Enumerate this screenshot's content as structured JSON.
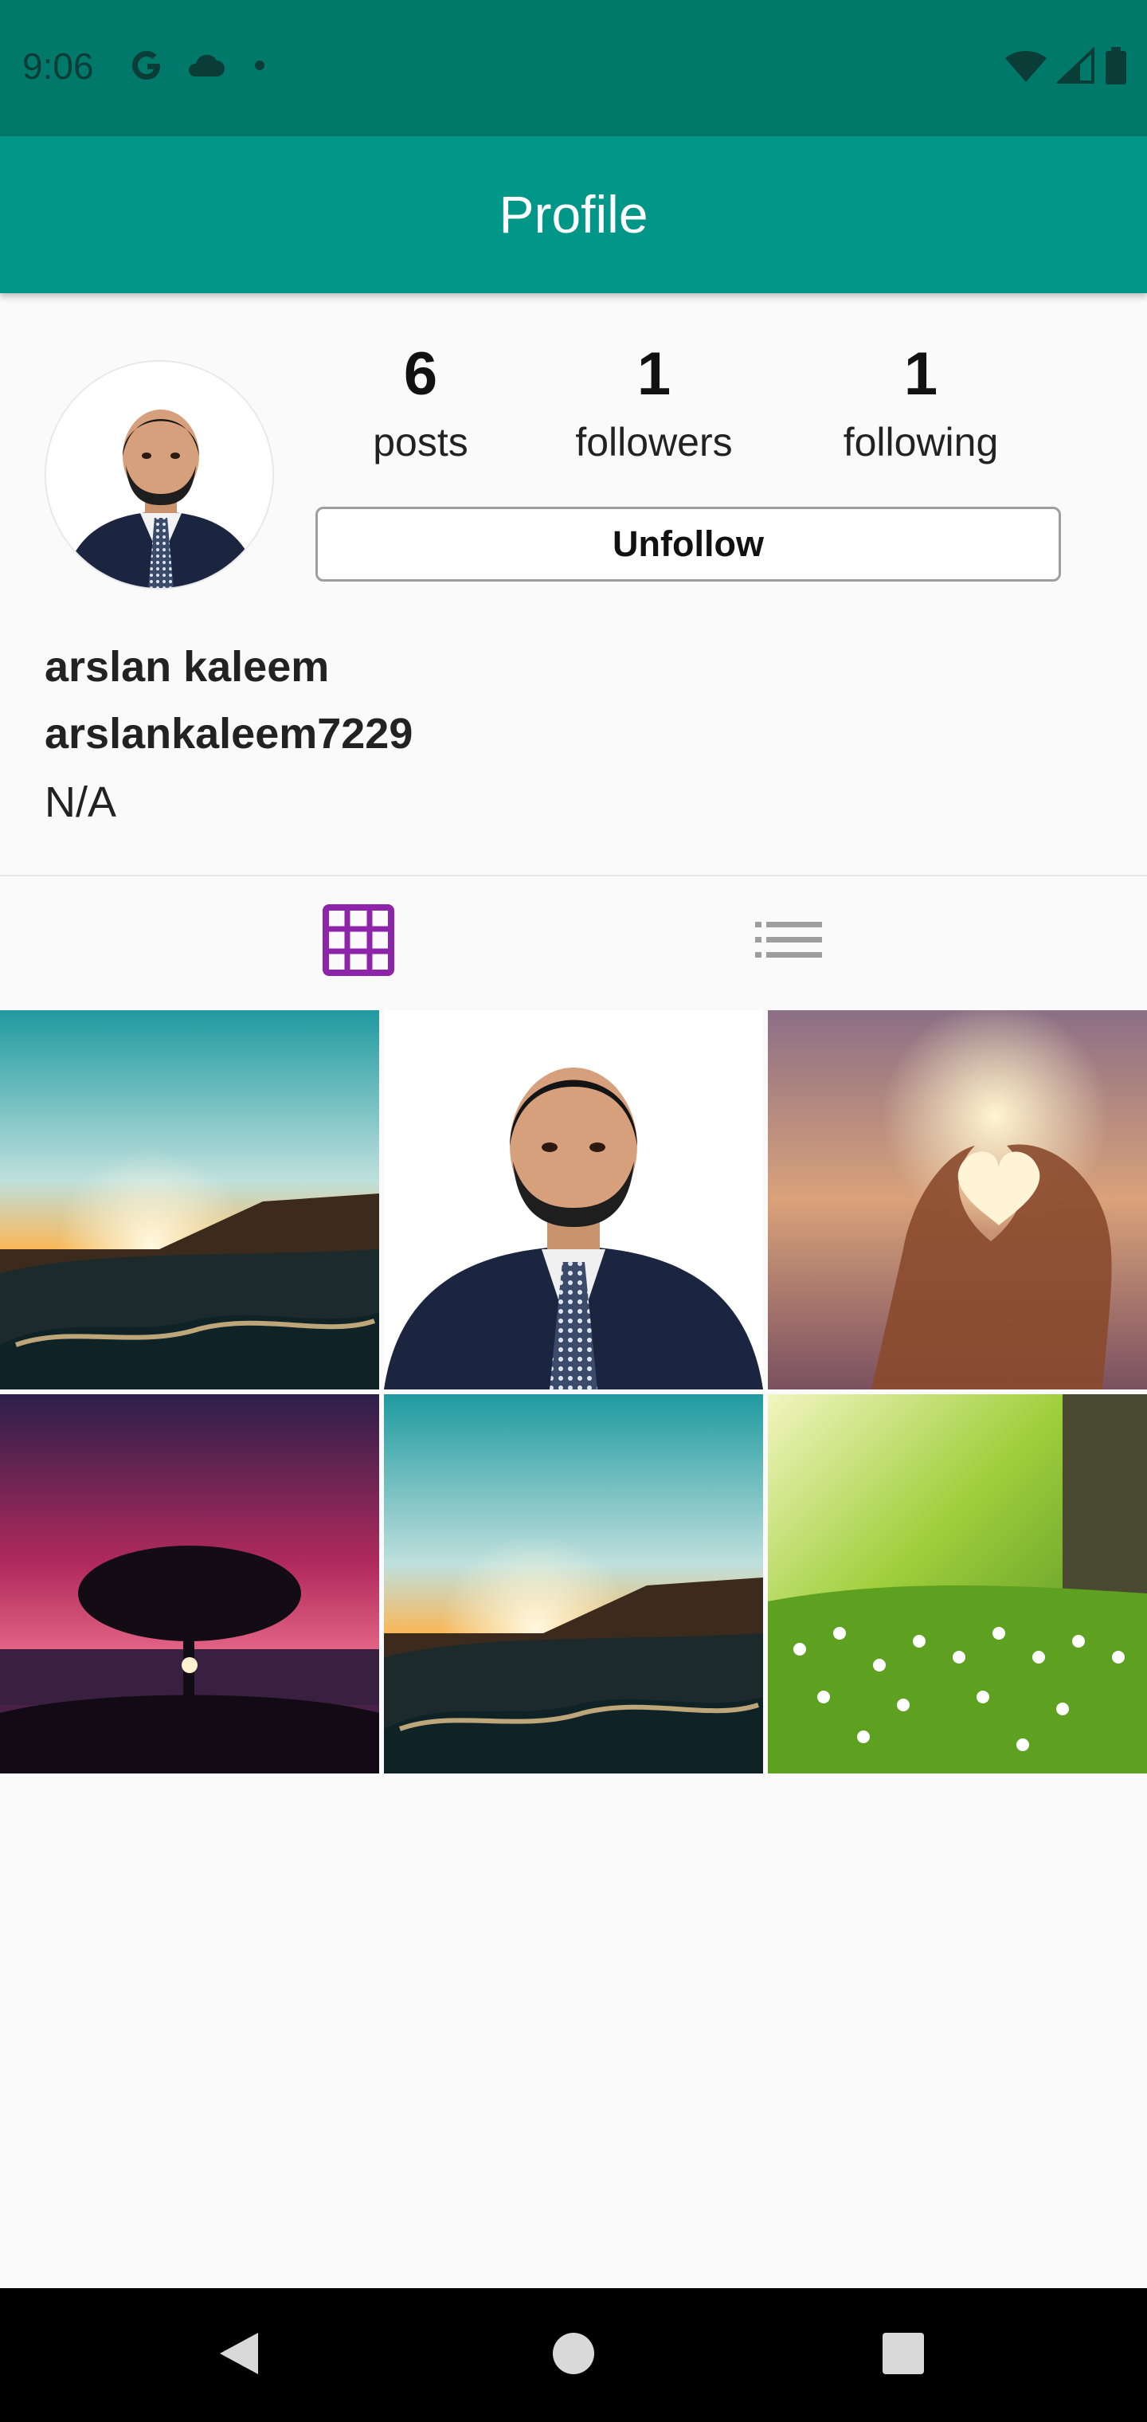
{
  "status_bar": {
    "time": "9:06",
    "left_icons": [
      "google-icon",
      "cloud-icon",
      "dot-icon"
    ],
    "right_icons": [
      "wifi-icon",
      "signal-icon",
      "battery-icon"
    ]
  },
  "app_bar": {
    "title": "Profile"
  },
  "profile": {
    "stats": [
      {
        "count": "6",
        "label": "posts"
      },
      {
        "count": "1",
        "label": "followers"
      },
      {
        "count": "1",
        "label": "following"
      }
    ],
    "unfollow_label": "Unfollow",
    "name": "arslan kaleem",
    "username": "arslankaleem7229",
    "bio": "N/A"
  },
  "tabs": [
    {
      "icon": "grid-view-icon",
      "active": true,
      "active_color": "#8e24aa"
    },
    {
      "icon": "list-view-icon",
      "active": false,
      "color": "#9e9e9e"
    }
  ],
  "posts": [
    {
      "subject": "sunset over hills"
    },
    {
      "subject": "portrait in suit"
    },
    {
      "subject": "heart hands against sunset"
    },
    {
      "subject": "tree silhouette at magenta dusk"
    },
    {
      "subject": "sunset over hills"
    },
    {
      "subject": "white flowers in green meadow"
    }
  ],
  "nav_bar": {
    "buttons": [
      "back-icon",
      "home-icon",
      "recents-icon"
    ]
  },
  "colors": {
    "status_bar": "#00796b",
    "app_bar": "#009688",
    "accent": "#8e24aa",
    "background": "#fafafa"
  }
}
